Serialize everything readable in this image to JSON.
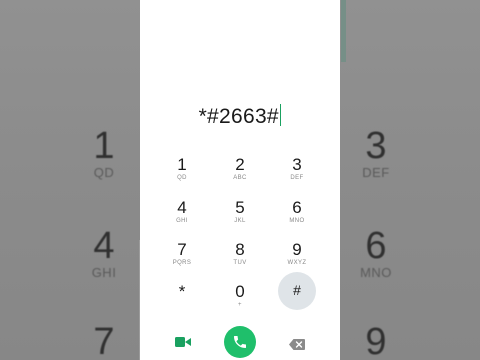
{
  "dialer": {
    "number": "*#2663#",
    "keys": [
      {
        "digit": "1",
        "letters": "QD"
      },
      {
        "digit": "2",
        "letters": "ABC"
      },
      {
        "digit": "3",
        "letters": "DEF"
      },
      {
        "digit": "4",
        "letters": "GHI"
      },
      {
        "digit": "5",
        "letters": "JKL"
      },
      {
        "digit": "6",
        "letters": "MNO"
      },
      {
        "digit": "7",
        "letters": "PQRS"
      },
      {
        "digit": "8",
        "letters": "TUV"
      },
      {
        "digit": "9",
        "letters": "WXYZ"
      },
      {
        "digit": "*",
        "letters": ""
      },
      {
        "digit": "0",
        "letters": "+"
      },
      {
        "digit": "#",
        "letters": ""
      }
    ]
  },
  "background": {
    "left": [
      {
        "digit": "1",
        "letters": "QD"
      },
      {
        "digit": "4",
        "letters": "GHI"
      },
      {
        "digit": "7",
        "letters": ""
      }
    ],
    "right": [
      {
        "digit": "3",
        "letters": "DEF"
      },
      {
        "digit": "6",
        "letters": "MNO"
      },
      {
        "digit": "9",
        "letters": ""
      }
    ]
  },
  "icons": {
    "video": "video-call-icon",
    "call": "phone-icon",
    "delete": "backspace-icon"
  },
  "colors": {
    "call_green": "#1fbf6b",
    "cursor_green": "#1aa160",
    "video_green": "#1aa160",
    "pressed_key_bg": "#dfe4e8"
  }
}
